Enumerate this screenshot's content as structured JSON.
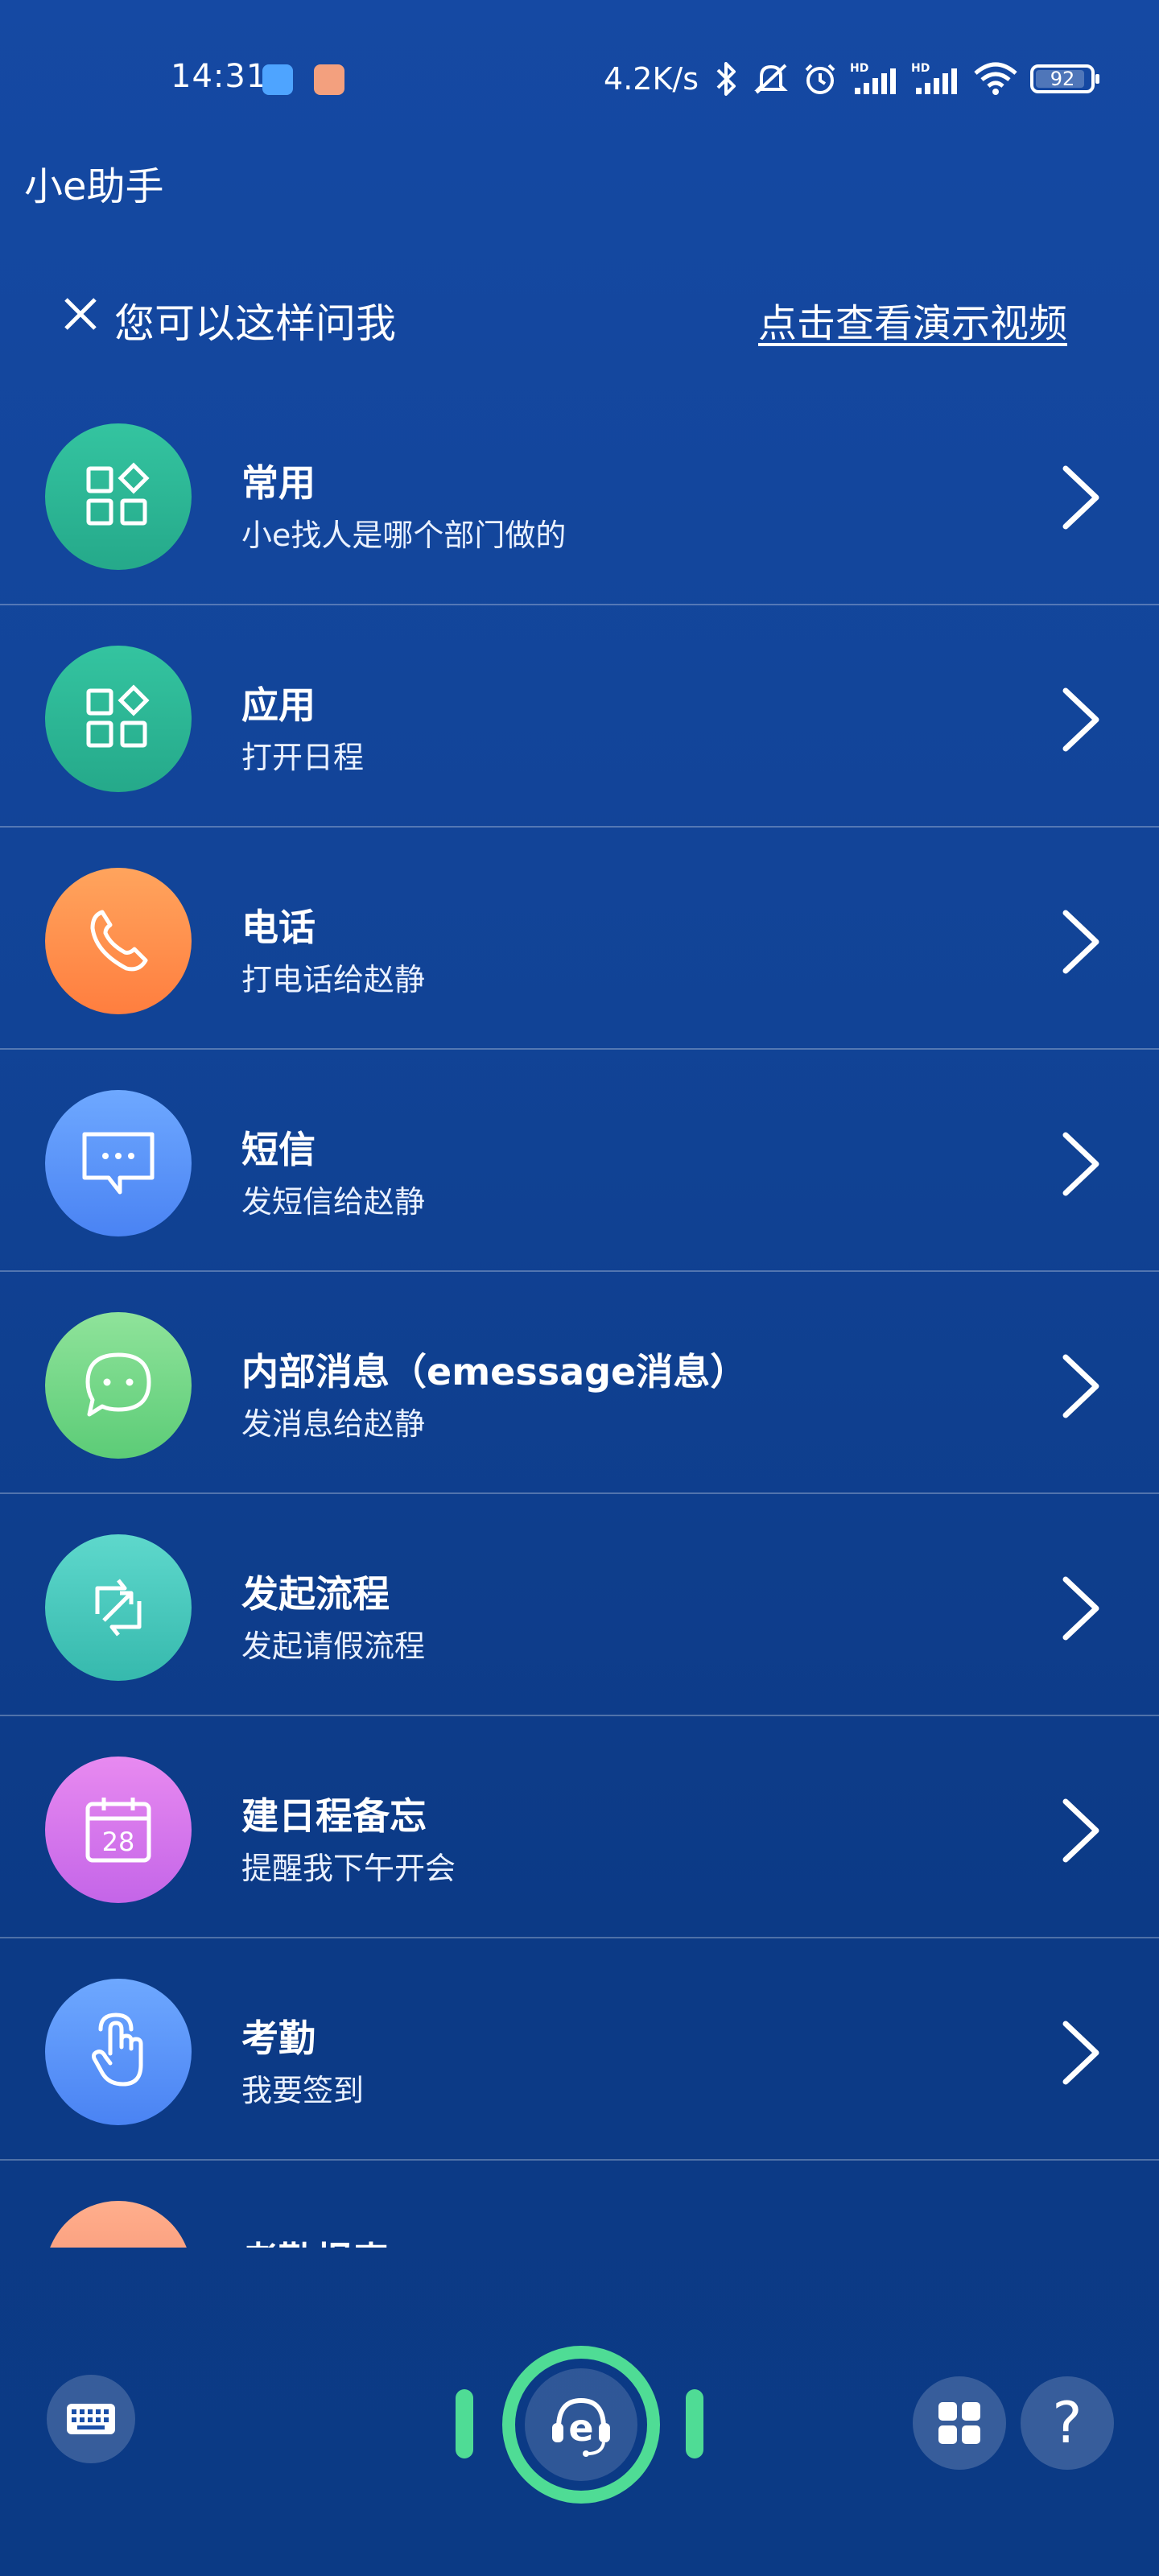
{
  "status_bar": {
    "time": "14:31",
    "net_speed": "4.2K/s",
    "battery": "92",
    "battery_level": 0.92
  },
  "header": {
    "title": "小e助手"
  },
  "hint": {
    "text": "您可以这样问我",
    "demo_link": "点击查看演示视频"
  },
  "commands": [
    {
      "title": "常用",
      "subtitle": "小e找人是哪个部门做的",
      "icon": "apps-grid-icon",
      "color_top": "#34c4a0",
      "color_bottom": "#25a98a"
    },
    {
      "title": "应用",
      "subtitle": "打开日程",
      "icon": "apps-grid-icon",
      "color_top": "#34c4a0",
      "color_bottom": "#25a98a"
    },
    {
      "title": "电话",
      "subtitle": "打电话给赵静",
      "icon": "phone-icon",
      "color_top": "#ffa45d",
      "color_bottom": "#ff7e3f"
    },
    {
      "title": "短信",
      "subtitle": "发短信给赵静",
      "icon": "sms-icon",
      "color_top": "#6ea8ff",
      "color_bottom": "#4a83f3"
    },
    {
      "title": "内部消息（emessage消息）",
      "subtitle": "发消息给赵静",
      "icon": "chat-bubble-icon",
      "color_top": "#8fe39a",
      "color_bottom": "#5ccc77"
    },
    {
      "title": "发起流程",
      "subtitle": "发起请假流程",
      "icon": "workflow-icon",
      "color_top": "#5ed8cc",
      "color_bottom": "#36b9ad"
    },
    {
      "title": "建日程备忘",
      "subtitle": "提醒我下午开会",
      "icon": "calendar-icon",
      "color_top": "#e88af0",
      "color_bottom": "#c465e8"
    },
    {
      "title": "考勤",
      "subtitle": "我要签到",
      "icon": "tap-hand-icon",
      "color_top": "#6ea8ff",
      "color_bottom": "#4a83f3"
    },
    {
      "title": "考勤报表",
      "subtitle": "",
      "icon": "report-icon",
      "color_top": "#ffae8c",
      "color_bottom": "#f48a6c"
    }
  ],
  "bottom": {
    "accent": "#4fdc95",
    "help_label": "?"
  }
}
